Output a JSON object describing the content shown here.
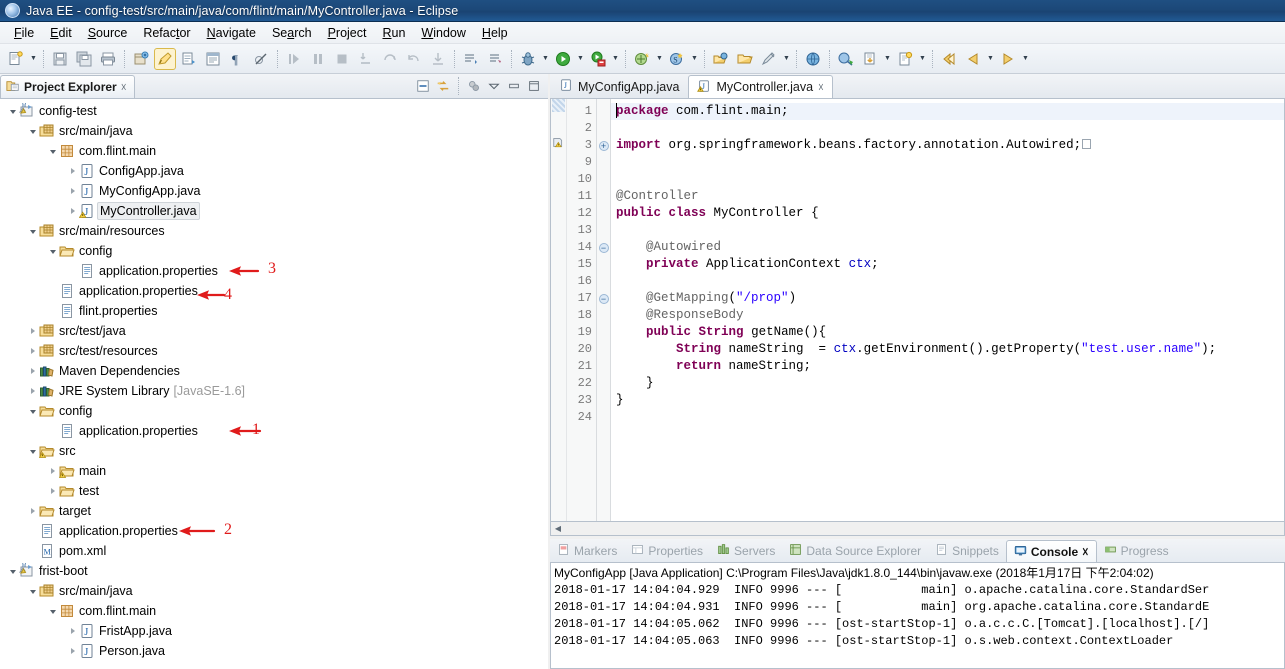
{
  "window": {
    "title": "Java EE - config-test/src/main/java/com/flint/main/MyController.java - Eclipse",
    "icon": "eclipse-icon"
  },
  "menubar": {
    "items": [
      {
        "label": "File",
        "mnemonic": "F"
      },
      {
        "label": "Edit",
        "mnemonic": "E"
      },
      {
        "label": "Source",
        "mnemonic": "S"
      },
      {
        "label": "Refactor",
        "mnemonic": "t"
      },
      {
        "label": "Navigate",
        "mnemonic": "N"
      },
      {
        "label": "Search",
        "mnemonic": "a"
      },
      {
        "label": "Project",
        "mnemonic": "P"
      },
      {
        "label": "Run",
        "mnemonic": "R"
      },
      {
        "label": "Window",
        "mnemonic": "W"
      },
      {
        "label": "Help",
        "mnemonic": "H"
      }
    ]
  },
  "toolbar": {
    "groups": [
      [
        "new-wizard-icon",
        "dropdown-arrow",
        "save-icon",
        "save-all-icon",
        "print-icon"
      ],
      [
        "new-java-package-icon",
        "toggle-mark-occurrences-icon",
        "open-task-icon",
        "open-type-icon",
        "show-whitespace-icon",
        "skip-breakpoints-icon"
      ],
      [
        "resume-icon",
        "suspend-icon",
        "terminate-icon",
        "step-into-icon",
        "step-over-icon",
        "step-return-icon",
        "drop-to-frame-icon"
      ],
      [
        "next-annotation-icon",
        "previous-annotation-icon"
      ],
      [
        "debug-icon",
        "dropdown-arrow",
        "run-icon",
        "dropdown-arrow",
        "run-as-server-icon",
        "dropdown-arrow"
      ],
      [
        "new-java-project-icon",
        "dropdown-arrow",
        "new-class-icon",
        "dropdown-arrow"
      ],
      [
        "open-perspective-icon",
        "open-folder-icon",
        "external-tools-icon",
        "dropdown-arrow"
      ],
      [
        "web-browser-icon",
        "open-web-icon",
        "download-icon",
        "dropdown-arrow",
        "new-file-icon",
        "dropdown-arrow"
      ],
      [
        "back-icon",
        "back-alt-icon",
        "dropdown-arrow",
        "forward-icon",
        "dropdown-arrow"
      ]
    ]
  },
  "explorer": {
    "tab_label": "Project Explorer",
    "tab_icon": "project-explorer-icon",
    "close_icon": "close-icon",
    "tools": [
      "collapse-all-icon",
      "link-with-editor-icon",
      "focus-on-active-task-icon",
      "view-menu-icon",
      "minimize-icon",
      "maximize-icon"
    ],
    "tree": [
      {
        "depth": 0,
        "twist": "open",
        "icon": "java-project-icon",
        "label": "config-test"
      },
      {
        "depth": 1,
        "twist": "open",
        "icon": "source-folder-icon",
        "label": "src/main/java"
      },
      {
        "depth": 2,
        "twist": "open",
        "icon": "package-icon",
        "label": "com.flint.main"
      },
      {
        "depth": 3,
        "twist": "closed",
        "icon": "java-file-icon",
        "label": "ConfigApp.java"
      },
      {
        "depth": 3,
        "twist": "closed",
        "icon": "java-file-icon",
        "label": "MyConfigApp.java"
      },
      {
        "depth": 3,
        "twist": "closed",
        "icon": "java-file-warning-icon",
        "label": "MyController.java",
        "selected": true
      },
      {
        "depth": 1,
        "twist": "open",
        "icon": "source-folder-icon",
        "label": "src/main/resources"
      },
      {
        "depth": 2,
        "twist": "open",
        "icon": "folder-icon",
        "label": "config"
      },
      {
        "depth": 3,
        "twist": "none",
        "icon": "properties-file-icon",
        "label": "application.properties",
        "anno": "3"
      },
      {
        "depth": 2,
        "twist": "none",
        "icon": "properties-file-icon",
        "label": "application.properties",
        "anno": "4"
      },
      {
        "depth": 2,
        "twist": "none",
        "icon": "properties-file-icon",
        "label": "flint.properties"
      },
      {
        "depth": 1,
        "twist": "closed",
        "icon": "source-folder-icon",
        "label": "src/test/java"
      },
      {
        "depth": 1,
        "twist": "closed",
        "icon": "source-folder-icon",
        "label": "src/test/resources"
      },
      {
        "depth": 1,
        "twist": "closed",
        "icon": "library-icon",
        "label": "Maven Dependencies"
      },
      {
        "depth": 1,
        "twist": "closed",
        "icon": "library-icon",
        "label": "JRE System Library",
        "sub": "[JavaSE-1.6]"
      },
      {
        "depth": 1,
        "twist": "open",
        "icon": "folder-icon",
        "label": "config"
      },
      {
        "depth": 2,
        "twist": "none",
        "icon": "properties-file-icon",
        "label": "application.properties",
        "anno": "1"
      },
      {
        "depth": 1,
        "twist": "open",
        "icon": "folder-warning-icon",
        "label": "src"
      },
      {
        "depth": 2,
        "twist": "closed",
        "icon": "folder-warning-icon",
        "label": "main"
      },
      {
        "depth": 2,
        "twist": "closed",
        "icon": "folder-icon",
        "label": "test"
      },
      {
        "depth": 1,
        "twist": "closed",
        "icon": "folder-icon",
        "label": "target"
      },
      {
        "depth": 1,
        "twist": "none",
        "icon": "properties-file-icon",
        "label": "application.properties",
        "anno": "2"
      },
      {
        "depth": 1,
        "twist": "none",
        "icon": "xml-file-icon",
        "label": "pom.xml"
      },
      {
        "depth": 0,
        "twist": "open",
        "icon": "java-project-icon",
        "label": "frist-boot"
      },
      {
        "depth": 1,
        "twist": "open",
        "icon": "source-folder-icon",
        "label": "src/main/java"
      },
      {
        "depth": 2,
        "twist": "open",
        "icon": "package-icon",
        "label": "com.flint.main"
      },
      {
        "depth": 3,
        "twist": "closed",
        "icon": "java-file-icon",
        "label": "FristApp.java"
      },
      {
        "depth": 3,
        "twist": "closed",
        "icon": "java-file-icon",
        "label": "Person.java"
      }
    ],
    "annotation_color": "#e01b1b"
  },
  "editor": {
    "tabs": [
      {
        "label": "MyConfigApp.java",
        "icon": "java-file-icon",
        "active": false
      },
      {
        "label": "MyController.java",
        "icon": "java-file-warning-icon",
        "active": true,
        "close_icon": "close-icon"
      }
    ],
    "lines": [
      {
        "num": "1",
        "fold": "",
        "text": "package com.flint.main;",
        "marker": "cursor"
      },
      {
        "num": "2",
        "fold": "",
        "text": ""
      },
      {
        "num": "3",
        "fold": "plus",
        "text": "import org.springframework.beans.factory.annotation.Autowired;",
        "marker": "warning"
      },
      {
        "num": "9",
        "fold": "",
        "text": ""
      },
      {
        "num": "10",
        "fold": "",
        "text": ""
      },
      {
        "num": "11",
        "fold": "",
        "text": "@Controller"
      },
      {
        "num": "12",
        "fold": "",
        "text": "public class MyController {"
      },
      {
        "num": "13",
        "fold": "",
        "text": ""
      },
      {
        "num": "14",
        "fold": "minus",
        "text": "    @Autowired"
      },
      {
        "num": "15",
        "fold": "",
        "text": "    private ApplicationContext ctx;"
      },
      {
        "num": "16",
        "fold": "",
        "text": ""
      },
      {
        "num": "17",
        "fold": "minus",
        "text": "    @GetMapping(\"/prop\")"
      },
      {
        "num": "18",
        "fold": "",
        "text": "    @ResponseBody"
      },
      {
        "num": "19",
        "fold": "",
        "text": "    public String getName(){"
      },
      {
        "num": "20",
        "fold": "",
        "text": "        String nameString  = ctx.getEnvironment().getProperty(\"test.user.name\");"
      },
      {
        "num": "21",
        "fold": "",
        "text": "        return nameString;"
      },
      {
        "num": "22",
        "fold": "",
        "text": "    }"
      },
      {
        "num": "23",
        "fold": "",
        "text": "}"
      },
      {
        "num": "24",
        "fold": "",
        "text": ""
      }
    ]
  },
  "bottom": {
    "tabs": [
      {
        "label": "Markers",
        "icon": "markers-icon",
        "active": false
      },
      {
        "label": "Properties",
        "icon": "properties-icon",
        "active": false
      },
      {
        "label": "Servers",
        "icon": "servers-icon",
        "active": false
      },
      {
        "label": "Data Source Explorer",
        "icon": "data-source-icon",
        "active": false
      },
      {
        "label": "Snippets",
        "icon": "snippets-icon",
        "active": false
      },
      {
        "label": "Console",
        "icon": "console-icon",
        "active": true,
        "close_icon": "close-icon"
      },
      {
        "label": "Progress",
        "icon": "progress-icon",
        "active": false
      }
    ],
    "console": {
      "header": "MyConfigApp [Java Application] C:\\Program Files\\Java\\jdk1.8.0_144\\bin\\javaw.exe (2018年1月17日 下午2:04:02)",
      "lines": [
        "2018-01-17 14:04:04.929  INFO 9996 --- [           main] o.apache.catalina.core.StandardSer",
        "2018-01-17 14:04:04.931  INFO 9996 --- [           main] org.apache.catalina.core.StandardE",
        "2018-01-17 14:04:05.062  INFO 9996 --- [ost-startStop-1] o.a.c.c.C.[Tomcat].[localhost].[/]",
        "2018-01-17 14:04:05.063  INFO 9996 --- [ost-startStop-1] o.s.web.context.ContextLoader"
      ]
    }
  },
  "colors": {
    "titlebar": "#1c4878",
    "keyword": "#7f0055",
    "string": "#2a00ff",
    "field": "#0000c0",
    "annotation_red": "#e01b1b"
  }
}
